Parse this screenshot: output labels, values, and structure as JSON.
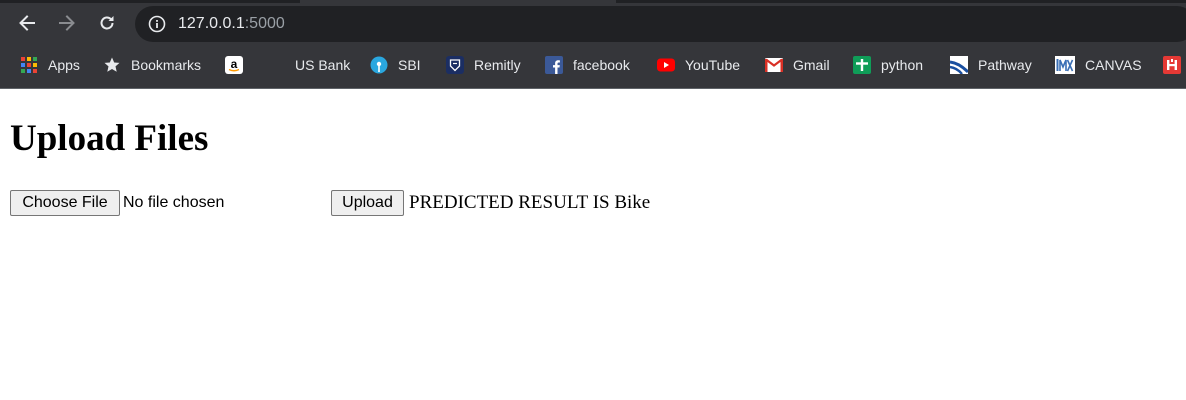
{
  "browser": {
    "url_host": "127.0.0.1",
    "url_port": ":5000",
    "bookmarks": [
      {
        "label": "Apps",
        "icon": "apps-grid-icon"
      },
      {
        "label": "Bookmarks",
        "icon": "star-icon"
      },
      {
        "label": "",
        "icon": "amazon-icon"
      },
      {
        "label": "US Bank",
        "icon": ""
      },
      {
        "label": "SBI",
        "icon": "sbi-icon"
      },
      {
        "label": "Remitly",
        "icon": "remitly-icon"
      },
      {
        "label": "facebook",
        "icon": "facebook-icon"
      },
      {
        "label": "YouTube",
        "icon": "youtube-icon"
      },
      {
        "label": "Gmail",
        "icon": "gmail-icon"
      },
      {
        "label": "python",
        "icon": "python-icon"
      },
      {
        "label": "Pathway",
        "icon": "pathway-icon"
      },
      {
        "label": "CANVAS",
        "icon": "canvas-icon"
      },
      {
        "label": "",
        "icon": "bookmark-icon"
      }
    ]
  },
  "page": {
    "title": "Upload Files",
    "choose_file_label": "Choose File",
    "file_status": "No file chosen",
    "upload_label": "Upload",
    "result_text": "PREDICTED RESULT IS Bike"
  },
  "colors": {
    "chrome_bg": "#35363a",
    "omnibox_bg": "#202124",
    "text_light": "#e8eaed",
    "text_dim": "#9aa0a6"
  }
}
